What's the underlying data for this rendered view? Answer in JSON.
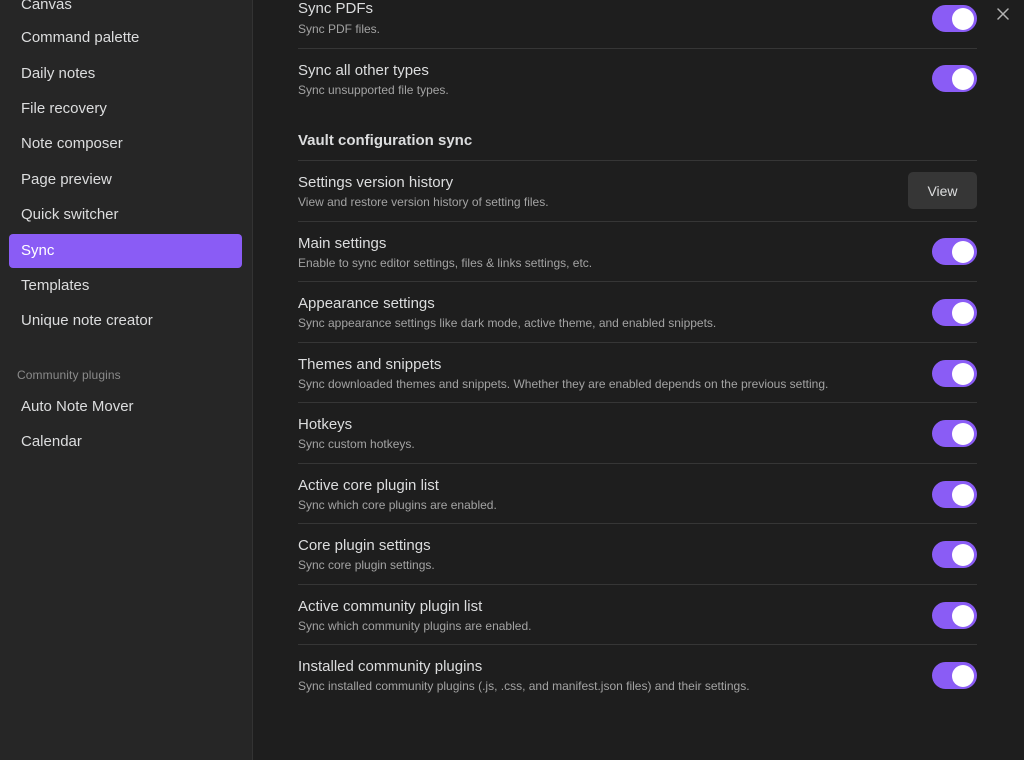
{
  "sidebar": {
    "items": [
      {
        "label": "Canvas",
        "active": false
      },
      {
        "label": "Command palette",
        "active": false
      },
      {
        "label": "Daily notes",
        "active": false
      },
      {
        "label": "File recovery",
        "active": false
      },
      {
        "label": "Note composer",
        "active": false
      },
      {
        "label": "Page preview",
        "active": false
      },
      {
        "label": "Quick switcher",
        "active": false
      },
      {
        "label": "Sync",
        "active": true
      },
      {
        "label": "Templates",
        "active": false
      },
      {
        "label": "Unique note creator",
        "active": false
      }
    ],
    "community_heading": "Community plugins",
    "community_items": [
      {
        "label": "Auto Note Mover"
      },
      {
        "label": "Calendar"
      }
    ]
  },
  "main": {
    "close_icon": "close-icon",
    "file_settings": [
      {
        "name": "Sync PDFs",
        "desc": "Sync PDF files.",
        "enabled": true
      },
      {
        "name": "Sync all other types",
        "desc": "Sync unsupported file types.",
        "enabled": true
      }
    ],
    "vault_heading": "Vault configuration sync",
    "version_history": {
      "name": "Settings version history",
      "desc": "View and restore version history of setting files.",
      "button_label": "View"
    },
    "vault_settings": [
      {
        "name": "Main settings",
        "desc": "Enable to sync editor settings, files & links settings, etc.",
        "enabled": true
      },
      {
        "name": "Appearance settings",
        "desc": "Sync appearance settings like dark mode, active theme, and enabled snippets.",
        "enabled": true
      },
      {
        "name": "Themes and snippets",
        "desc": "Sync downloaded themes and snippets. Whether they are enabled depends on the previous setting.",
        "enabled": true
      },
      {
        "name": "Hotkeys",
        "desc": "Sync custom hotkeys.",
        "enabled": true
      },
      {
        "name": "Active core plugin list",
        "desc": "Sync which core plugins are enabled.",
        "enabled": true
      },
      {
        "name": "Core plugin settings",
        "desc": "Sync core plugin settings.",
        "enabled": true
      },
      {
        "name": "Active community plugin list",
        "desc": "Sync which community plugins are enabled.",
        "enabled": true
      },
      {
        "name": "Installed community plugins",
        "desc": "Sync installed community plugins (.js, .css, and manifest.json files) and their settings.",
        "enabled": true
      }
    ]
  },
  "colors": {
    "accent": "#8a5cf5",
    "background": "#1e1e1e",
    "sidebar": "#262626"
  }
}
